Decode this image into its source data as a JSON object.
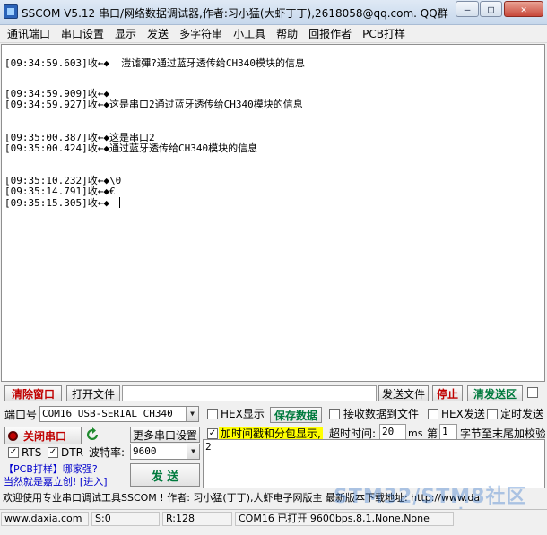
{
  "window": {
    "title": "SSCOM V5.12 串口/网络数据调试器,作者:习小猛(大虾丁丁),2618058@qq.com. QQ群"
  },
  "menu": [
    "通讯端口",
    "串口设置",
    "显示",
    "发送",
    "多字符串",
    "小工具",
    "帮助",
    "回报作者",
    "PCB打样"
  ],
  "receive_lines": [
    "[09:34:59.603]收←◆  溰谑彃?通过蓝牙透传给CH340模块的信息",
    "[09:34:59.909]收←◆",
    "[09:34:59.927]收←◆这是串口2通过蓝牙透传给CH340模块的信息",
    "[09:35:00.387]收←◆这是串口2",
    "[09:35:00.424]收←◆通过蓝牙透传给CH340模块的信息",
    "[09:35:10.232]收←◆\\0",
    "[09:35:14.791]收←◆€",
    "[09:35:15.305]收←◆ "
  ],
  "toolbar": {
    "clear_window": "清除窗口",
    "open_file": "打开文件",
    "file_path": "",
    "send_file": "发送文件",
    "stop": "停止",
    "clear_send": "清发送区"
  },
  "port": {
    "label": "端口号",
    "value": "COM16 USB-SERIAL CH340",
    "close_button": "关闭串口",
    "more_settings": "更多串口设置",
    "rts": "RTS",
    "dtr": "DTR",
    "baud_label": "波特率:",
    "baud_value": "9600"
  },
  "options": {
    "hex_display": "HEX显示",
    "save_data": "保存数据",
    "recv_to_file": "接收数据到文件",
    "hex_send": "HEX发送",
    "timed_send": "定时发送",
    "add_timestamp": "加时间戳和分包显示,",
    "timeout_label": "超时时间:",
    "timeout_value": "20",
    "timeout_unit": "ms",
    "page_label": "第",
    "page_value": "1",
    "checksum_label": "字节至末尾加校验"
  },
  "promo": {
    "line1": "【PCB打样】哪家强?",
    "line2": "当然就是嘉立创! [进入]"
  },
  "send": {
    "button": "发 送",
    "text": "2"
  },
  "ticker": "欢迎使用专业串口调试工具SSCOM !  作者: 习小猛(丁丁),大虾电子网版主  最新版本下载地址: http://www.da",
  "status": {
    "website": "www.daxia.com",
    "sent": "S:0",
    "received": "R:128",
    "port_status": "COM16 已打开  9600bps,8,1,None,None"
  },
  "watermark": {
    "line1": "STM32/STM8社区",
    "line2": "www.stmcu.org"
  }
}
